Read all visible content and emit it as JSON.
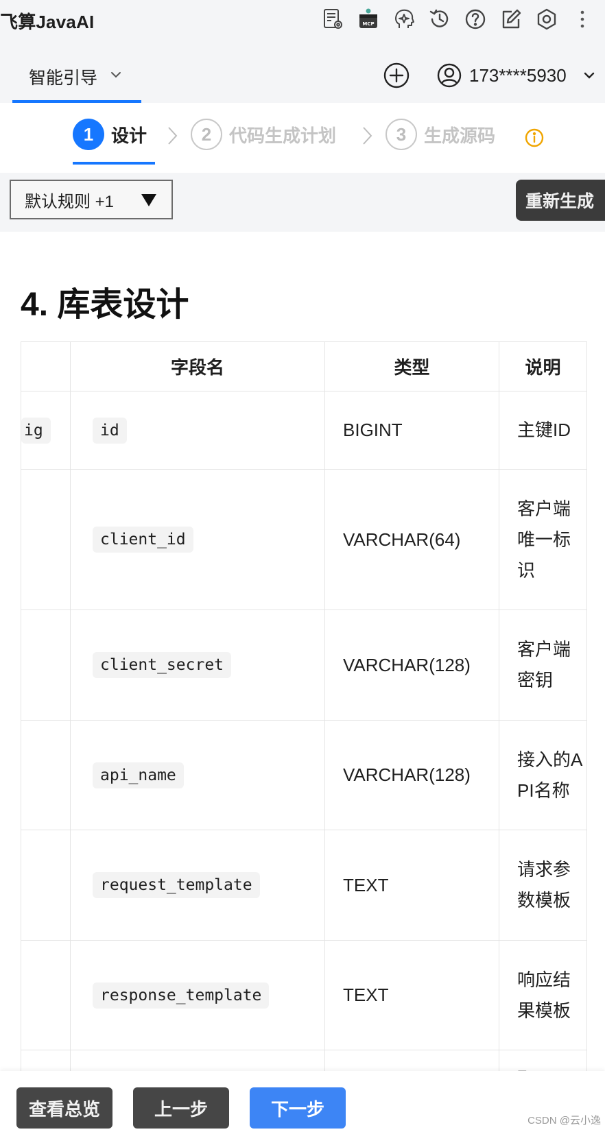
{
  "app": {
    "title": "飞算JavaAI"
  },
  "toolbar": {
    "icons": [
      "document-settings-icon",
      "mcp-icon",
      "brain-icon",
      "history-icon",
      "help-icon",
      "edit-icon",
      "settings-icon",
      "more-icon"
    ],
    "mcp_label": "MCP"
  },
  "nav": {
    "tab_label": "智能引导",
    "user_phone": "173****5930"
  },
  "steps": [
    {
      "number": "1",
      "label": "设计",
      "state": "active"
    },
    {
      "number": "2",
      "label": "代码生成计划",
      "state": "inactive"
    },
    {
      "number": "3",
      "label": "生成源码",
      "state": "inactive"
    }
  ],
  "rules": {
    "selected": "默认规则 +1",
    "regenerate_label": "重新生成"
  },
  "content": {
    "heading": "4. 库表设计",
    "table": {
      "headers": [
        "",
        "字段名",
        "类型",
        "说明"
      ],
      "rows": [
        {
          "config": "ig",
          "field": "id",
          "type": "BIGINT",
          "description": "主键ID"
        },
        {
          "config": "",
          "field": "client_id",
          "type": "VARCHAR(64)",
          "description": "客户端唯一标识"
        },
        {
          "config": "",
          "field": "client_secret",
          "type": "VARCHAR(128)",
          "description": "客户端密钥"
        },
        {
          "config": "",
          "field": "api_name",
          "type": "VARCHAR(128)",
          "description": "接入的API名称"
        },
        {
          "config": "",
          "field": "request_template",
          "type": "TEXT",
          "description": "请求参数模板"
        },
        {
          "config": "",
          "field": "response_template",
          "type": "TEXT",
          "description": "响应结果模板"
        },
        {
          "config": "",
          "field": "",
          "type": "",
          "description": "配置"
        }
      ]
    }
  },
  "footer": {
    "overview_label": "查看总览",
    "prev_label": "上一步",
    "next_label": "下一步",
    "watermark": "CSDN @云小逸"
  },
  "colors": {
    "accent": "#1677ff",
    "primary_button": "#3d85f5",
    "dark_button": "#464646",
    "info": "#f0a500"
  }
}
